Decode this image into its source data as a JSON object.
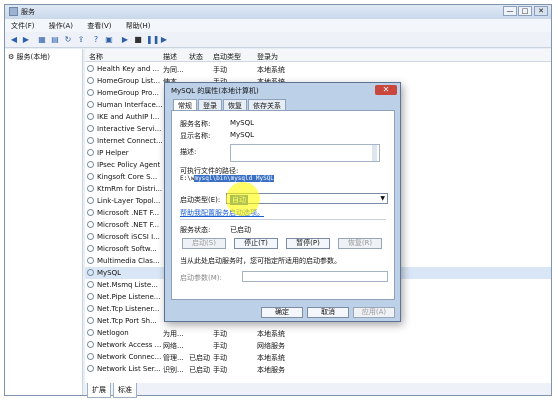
{
  "window": {
    "title": "服务",
    "min": "—",
    "max": "□",
    "close": "✕"
  },
  "menu": [
    "文件(F)",
    "操作(A)",
    "查看(V)",
    "帮助(H)"
  ],
  "tree": {
    "node": "服务(本地)"
  },
  "columns": [
    "名称",
    "描述",
    "状态",
    "启动类型",
    "登录为"
  ],
  "rows": [
    [
      "Health Key and ...",
      "为同...",
      "",
      "手动",
      "本地系统"
    ],
    [
      "HomeGroup List...",
      "使本...",
      "",
      "手动",
      "本地系统"
    ],
    [
      "HomeGroup Pro...",
      "",
      "",
      "",
      ""
    ],
    [
      "Human Interface...",
      "",
      "",
      "",
      ""
    ],
    [
      "IKE and AuthIP I...",
      "",
      "",
      "",
      ""
    ],
    [
      "Interactive Servi...",
      "",
      "",
      "",
      ""
    ],
    [
      "Internet Connect...",
      "",
      "",
      "",
      ""
    ],
    [
      "IP Helper",
      "",
      "",
      "",
      ""
    ],
    [
      "IPsec Policy Agent",
      "",
      "",
      "",
      ""
    ],
    [
      "Kingsoft Core S...",
      "",
      "",
      "",
      ""
    ],
    [
      "KtmRm for Distri...",
      "",
      "",
      "",
      ""
    ],
    [
      "Link-Layer Topol...",
      "",
      "",
      "",
      ""
    ],
    [
      "Microsoft .NET F...",
      "",
      "",
      "",
      ""
    ],
    [
      "Microsoft .NET F...",
      "",
      "",
      "",
      ""
    ],
    [
      "Microsoft iSCSI I...",
      "",
      "",
      "",
      ""
    ],
    [
      "Microsoft Softw...",
      "",
      "",
      "",
      ""
    ],
    [
      "Multimedia Clas...",
      "",
      "",
      "",
      ""
    ],
    [
      "MySQL",
      "",
      "",
      "",
      ""
    ],
    [
      "Net.Msmq Liste...",
      "",
      "",
      "",
      ""
    ],
    [
      "Net.Pipe Listene...",
      "",
      "",
      "",
      ""
    ],
    [
      "Net.Tcp Listener...",
      "",
      "",
      "",
      ""
    ],
    [
      "Net.Tcp Port Sh...",
      "",
      "",
      "",
      ""
    ],
    [
      "Netlogon",
      "为用...",
      "",
      "手动",
      "本地系统"
    ],
    [
      "Network Access ...",
      "网络...",
      "",
      "手动",
      "网络服务"
    ],
    [
      "Network Connec...",
      "管理...",
      "已启动",
      "手动",
      "本地系统"
    ],
    [
      "Network List Ser...",
      "识别...",
      "已启动",
      "手动",
      "本地服务"
    ]
  ],
  "bottom_tabs": [
    "扩展",
    "标准"
  ],
  "dialog": {
    "title": "MySQL 的属性(本地计算机)",
    "close": "✕",
    "tabs": [
      "常规",
      "登录",
      "恢复",
      "依存关系"
    ],
    "service_name_label": "服务名称:",
    "service_name": "MySQL",
    "display_name_label": "显示名称:",
    "display_name": "MySQL",
    "description_label": "描述:",
    "exe_label": "可执行文件的路径:",
    "exe_prefix": "E:\\w",
    "exe_rest": "mysql\\bin\\mysqld MySQL",
    "startup_label": "启动类型(E):",
    "startup_value": "自动",
    "help_link": "帮助我配置服务启动选项。",
    "status_label": "服务状态:",
    "status_value": "已启动",
    "btn_start": "启动(S)",
    "btn_stop": "停止(T)",
    "btn_pause": "暂停(P)",
    "btn_resume": "恢复(R)",
    "params_hint": "当从此处启动服务时，您可指定所适用的启动参数。",
    "params_label": "启动参数(M):",
    "ok": "确定",
    "cancel": "取消",
    "apply": "应用(A)"
  }
}
